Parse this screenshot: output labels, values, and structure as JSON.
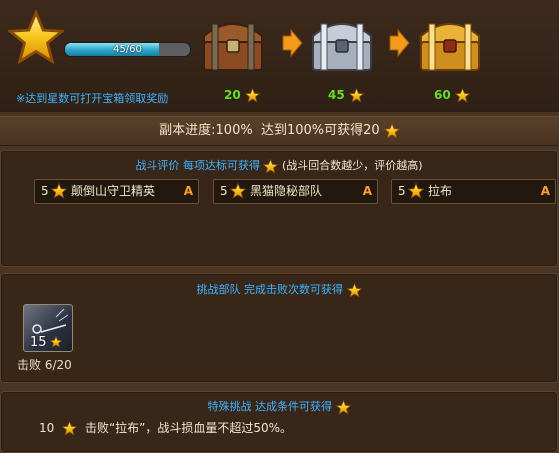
{
  "top": {
    "progress_text": "45/60",
    "progress_fraction": 0.75,
    "hint": "※达到星数可打开宝箱领取奖励",
    "chests": [
      {
        "requirement": "20",
        "icon": "wooden-chest-icon"
      },
      {
        "requirement": "45",
        "icon": "silver-chest-icon"
      },
      {
        "requirement": "60",
        "icon": "gold-chest-icon"
      }
    ]
  },
  "progress_line": "副本进度:100%  达到100%可获得20",
  "battle_rating": {
    "title": "战斗评价 每项达标可获得",
    "note": "(战斗回合数越少，评价越高)",
    "items": [
      {
        "stars": "5",
        "name": "颠倒山守卫精英",
        "grade": "A"
      },
      {
        "stars": "5",
        "name": "黑猫隐秘部队",
        "grade": "A"
      },
      {
        "stars": "5",
        "name": "拉布",
        "grade": "A"
      }
    ]
  },
  "challenge": {
    "title": "挑战部队 完成击败次数可获得",
    "unit_level": "15",
    "kill_text": "击败 6/20"
  },
  "special": {
    "title": "特殊挑战 达成条件可获得",
    "reward": "10",
    "condition": "击败“拉布”，战斗损血量不超过50%。"
  },
  "colors": {
    "star": "#f7c51c",
    "accent_blue": "#3fb3ff",
    "green": "#63dd2a",
    "grade": "#ff9f2a"
  }
}
